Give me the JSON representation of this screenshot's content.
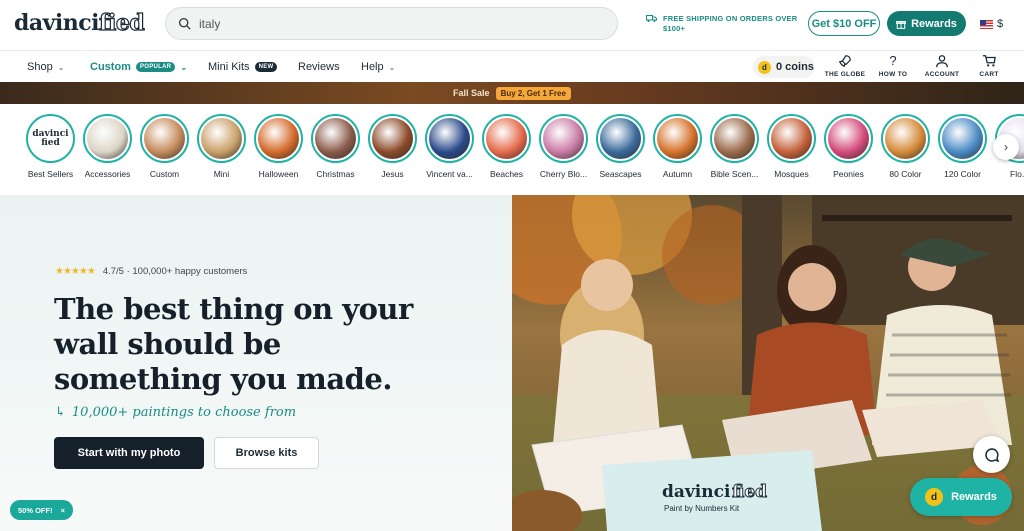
{
  "brand": {
    "logo_main": "davinci",
    "logo_accent": "fied"
  },
  "search": {
    "value": "italy"
  },
  "shipping": {
    "text": "FREE SHIPPING ON ORDERS OVER $100+"
  },
  "header": {
    "get10_label": "Get $10 OFF",
    "rewards_label": "Rewards",
    "currency": "$"
  },
  "nav": {
    "shop": "Shop",
    "custom": "Custom",
    "custom_badge": "POPULAR",
    "mini": "Mini Kits",
    "mini_badge": "NEW",
    "reviews": "Reviews",
    "help": "Help",
    "coins_label": "0 coins",
    "coin_letter": "d",
    "globe": "THE GLOBE",
    "howto": "HOW TO",
    "account": "ACCOUNT",
    "cart": "CART"
  },
  "sale": {
    "label": "Fall Sale",
    "pill": "Buy 2, Get 1 Free"
  },
  "categories": [
    {
      "name": "Best Sellers",
      "color": "#ffffff"
    },
    {
      "name": "Accessories",
      "color": "#dcd5c6"
    },
    {
      "name": "Custom",
      "color": "#c48a5c"
    },
    {
      "name": "Mini",
      "color": "#c9a06a"
    },
    {
      "name": "Halloween",
      "color": "#d46a2a"
    },
    {
      "name": "Christmas",
      "color": "#8a5a4a"
    },
    {
      "name": "Jesus",
      "color": "#8c4a2a"
    },
    {
      "name": "Vincent va...",
      "color": "#2a4a8a"
    },
    {
      "name": "Beaches",
      "color": "#e46a4a"
    },
    {
      "name": "Cherry Blo...",
      "color": "#c87aa4"
    },
    {
      "name": "Seascapes",
      "color": "#3a6a9a"
    },
    {
      "name": "Autumn",
      "color": "#d4722a"
    },
    {
      "name": "Bible Scen...",
      "color": "#9a6a4a"
    },
    {
      "name": "Mosques",
      "color": "#c4603a"
    },
    {
      "name": "Peonies",
      "color": "#d44a7a"
    },
    {
      "name": "80 Color",
      "color": "#d48a3a"
    },
    {
      "name": "120 Color",
      "color": "#4a8ac4"
    },
    {
      "name": "Flo...",
      "color": "#e8e0f0"
    }
  ],
  "hero": {
    "rating_text": "4.7/5 · 100,000+ happy customers",
    "headline": "The best thing on your wall should be something you made.",
    "sub": "10,000+ paintings to choose from",
    "cta_primary": "Start with my photo",
    "cta_secondary": "Browse kits",
    "promo": "50% OFF!",
    "box_logo_main": "davinci",
    "box_logo_accent": "fied",
    "box_caption": "Paint by Numbers Kit"
  },
  "float": {
    "rewards_label": "Rewards",
    "coin_letter": "d"
  },
  "colors": {
    "teal": "#1a8c84",
    "dark": "#15202b",
    "star": "#f5b52a"
  }
}
